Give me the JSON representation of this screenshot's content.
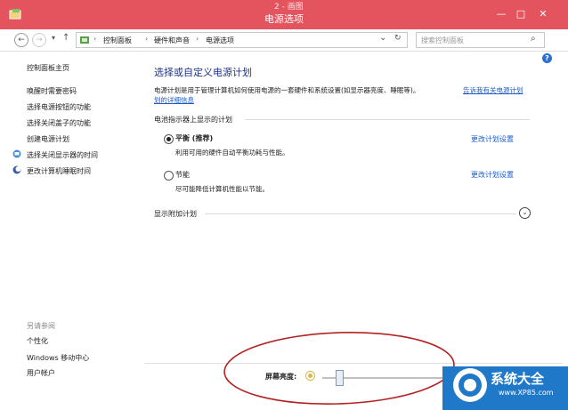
{
  "window": {
    "title": "电源选项",
    "background_text": "2 - 画图",
    "controls": {
      "minimize": "—",
      "maximize": "□",
      "close": "✕"
    }
  },
  "nav": {
    "back": "←",
    "forward": "→",
    "dropdown": "▾",
    "up": "↑",
    "breadcrumbs": [
      "控制面板",
      "硬件和声音",
      "电源选项"
    ],
    "separator": "›",
    "address_dropdown": "⌄",
    "refresh": "↻",
    "search_placeholder": "搜索控制面板",
    "search_icon": "⌕",
    "help": "?"
  },
  "sidebar": {
    "home": "控制面板主页",
    "items": [
      "唤醒时需要密码",
      "选择电源按钮的功能",
      "选择关闭盖子的功能",
      "创建电源计划",
      "选择关闭显示器的时间",
      "更改计算机睡眠时间"
    ],
    "see_also_header": "另请参阅",
    "see_also": [
      "个性化",
      "Windows 移动中心",
      "用户帐户"
    ]
  },
  "main": {
    "title": "选择或自定义电源计划",
    "description": "电源计划是用于管理计算机如何使用电源的一套硬件和系统设置(如显示器亮度、睡眠等)。",
    "link_part1": "告诉我有关电源计划",
    "link_part2": "划的详细信息",
    "group_header": "电池指示器上显示的计划",
    "plans": [
      {
        "name": "平衡 (推荐)",
        "desc": "利用可用的硬件自动平衡功耗与性能。",
        "selected": true,
        "change": "更改计划设置"
      },
      {
        "name": "节能",
        "desc": "尽可能降低计算机性能以节能。",
        "selected": false,
        "change": "更改计划设置"
      }
    ],
    "extra_plans": "显示附加计划",
    "expand_glyph": "⌄"
  },
  "brightness": {
    "label": "屏幕亮度:",
    "level": 0.1
  },
  "watermark": {
    "text": "系统大全",
    "url": "www.XP85.com"
  },
  "colors": {
    "titlebar": "#e3545e",
    "annotation": "#b22222",
    "link": "#1a5ac6",
    "heading": "#1e3287",
    "watermark": "#1f78c8"
  }
}
